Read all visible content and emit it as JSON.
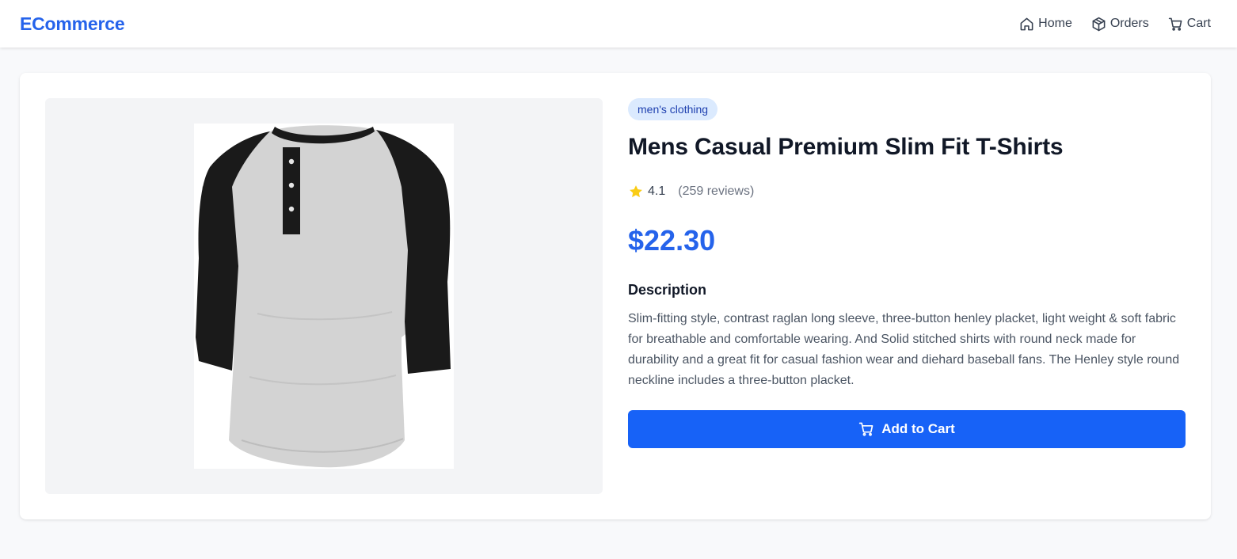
{
  "navbar": {
    "brand": "ECommerce",
    "links": [
      {
        "label": "Home",
        "icon": "home-icon"
      },
      {
        "label": "Orders",
        "icon": "package-icon"
      },
      {
        "label": "Cart",
        "icon": "cart-icon"
      }
    ]
  },
  "product": {
    "category": "men's clothing",
    "title": "Mens Casual Premium Slim Fit T-Shirts",
    "rating": "4.1",
    "reviews": "(259 reviews)",
    "price": "$22.30",
    "description_heading": "Description",
    "description": "Slim-fitting style, contrast raglan long sleeve, three-button henley placket, light weight & soft fabric for breathable and comfortable wearing. And Solid stitched shirts with round neck made for durability and a great fit for casual fashion wear and diehard baseball fans. The Henley style round neckline includes a three-button placket.",
    "add_to_cart_label": "Add to Cart"
  },
  "colors": {
    "brand": "#2563eb",
    "primary_button": "#1762f7",
    "badge_bg": "#dbeafe",
    "badge_text": "#1e40af",
    "star": "#facc15"
  }
}
